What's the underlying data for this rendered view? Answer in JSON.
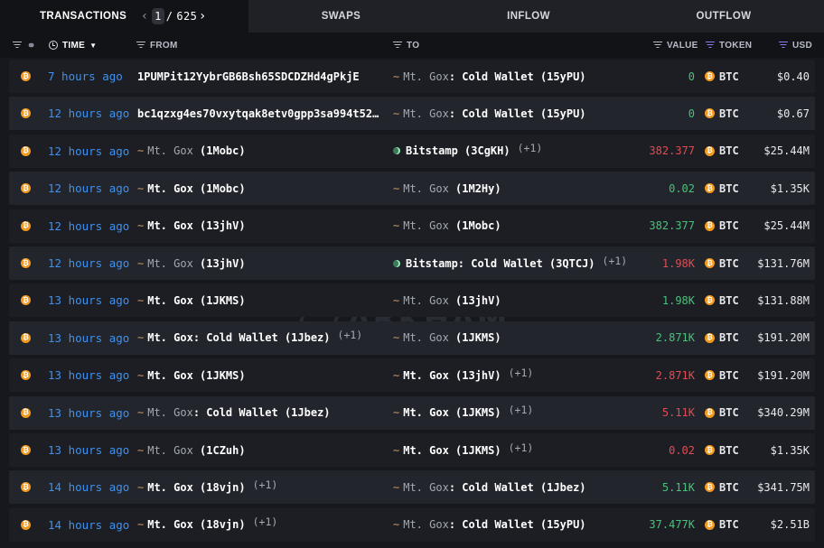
{
  "tabs": {
    "transactions": "TRANSACTIONS",
    "page_current": "1",
    "page_total": "625",
    "swaps": "SWAPS",
    "inflow": "INFLOW",
    "outflow": "OUTFLOW"
  },
  "header": {
    "time": "TIME",
    "from": "FROM",
    "to": "TO",
    "value": "VALUE",
    "token": "TOKEN",
    "usd": "USD"
  },
  "watermark": "ARKHAM",
  "colors": {
    "accent_time": "#3e91f0",
    "inflow": "#49c27b",
    "outflow": "#e14d52",
    "btc": "#f49a1e"
  },
  "rows": [
    {
      "time": "7 hours ago",
      "from": {
        "type": "address",
        "text": "1PUMPit12YybrGB6Bsh65SDCDZHd4gPkjE"
      },
      "to": {
        "type": "gox",
        "name": "Mt. Gox",
        "label": ": Cold Wallet (15yPU)",
        "bold": false,
        "plus": ""
      },
      "value": "0",
      "dir": "in",
      "token": "BTC",
      "usd": "$0.40"
    },
    {
      "time": "12 hours ago",
      "from": {
        "type": "address",
        "text": "bc1qzxg4es70vxytqak8etv0gpp3sa994t52…"
      },
      "to": {
        "type": "gox",
        "name": "Mt. Gox",
        "label": ": Cold Wallet (15yPU)",
        "bold": false,
        "plus": ""
      },
      "value": "0",
      "dir": "in",
      "token": "BTC",
      "usd": "$0.67"
    },
    {
      "time": "12 hours ago",
      "from": {
        "type": "gox",
        "name": "Mt. Gox",
        "label": " (1Mobc)",
        "bold": false,
        "plus": ""
      },
      "to": {
        "type": "bitstamp",
        "name": "Bitstamp",
        "label": " (3CgKH)",
        "bold": true,
        "plus": "(+1)"
      },
      "value": "382.377",
      "dir": "out",
      "token": "BTC",
      "usd": "$25.44M"
    },
    {
      "time": "12 hours ago",
      "from": {
        "type": "gox",
        "name": "Mt. Gox",
        "label": " (1Mobc)",
        "bold": true,
        "plus": ""
      },
      "to": {
        "type": "gox",
        "name": "Mt. Gox",
        "label": " (1M2Hy)",
        "bold": false,
        "plus": ""
      },
      "value": "0.02",
      "dir": "in",
      "token": "BTC",
      "usd": "$1.35K"
    },
    {
      "time": "12 hours ago",
      "from": {
        "type": "gox",
        "name": "Mt. Gox",
        "label": " (13jhV)",
        "bold": true,
        "plus": ""
      },
      "to": {
        "type": "gox",
        "name": "Mt. Gox",
        "label": " (1Mobc)",
        "bold": false,
        "plus": ""
      },
      "value": "382.377",
      "dir": "in",
      "token": "BTC",
      "usd": "$25.44M"
    },
    {
      "time": "12 hours ago",
      "from": {
        "type": "gox",
        "name": "Mt. Gox",
        "label": " (13jhV)",
        "bold": false,
        "plus": ""
      },
      "to": {
        "type": "bitstamp",
        "name": "Bitstamp",
        "label": ": Cold Wallet (3QTCJ)",
        "bold": true,
        "plus": "(+1)"
      },
      "value": "1.98K",
      "dir": "out",
      "token": "BTC",
      "usd": "$131.76M"
    },
    {
      "time": "13 hours ago",
      "from": {
        "type": "gox",
        "name": "Mt. Gox",
        "label": " (1JKMS)",
        "bold": true,
        "plus": ""
      },
      "to": {
        "type": "gox",
        "name": "Mt. Gox",
        "label": " (13jhV)",
        "bold": false,
        "plus": ""
      },
      "value": "1.98K",
      "dir": "in",
      "token": "BTC",
      "usd": "$131.88M"
    },
    {
      "time": "13 hours ago",
      "from": {
        "type": "gox",
        "name": "Mt. Gox",
        "label": ": Cold Wallet (1Jbez)",
        "bold": true,
        "plus": "(+1)"
      },
      "to": {
        "type": "gox",
        "name": "Mt. Gox",
        "label": " (1JKMS)",
        "bold": false,
        "plus": ""
      },
      "value": "2.871K",
      "dir": "in",
      "token": "BTC",
      "usd": "$191.20M"
    },
    {
      "time": "13 hours ago",
      "from": {
        "type": "gox",
        "name": "Mt. Gox",
        "label": " (1JKMS)",
        "bold": true,
        "plus": ""
      },
      "to": {
        "type": "gox",
        "name": "Mt. Gox",
        "label": " (13jhV)",
        "bold": true,
        "plus": "(+1)"
      },
      "value": "2.871K",
      "dir": "out",
      "token": "BTC",
      "usd": "$191.20M"
    },
    {
      "time": "13 hours ago",
      "from": {
        "type": "gox",
        "name": "Mt. Gox",
        "label": ": Cold Wallet (1Jbez)",
        "bold": false,
        "plus": ""
      },
      "to": {
        "type": "gox",
        "name": "Mt. Gox",
        "label": " (1JKMS)",
        "bold": true,
        "plus": "(+1)"
      },
      "value": "5.11K",
      "dir": "out",
      "token": "BTC",
      "usd": "$340.29M"
    },
    {
      "time": "13 hours ago",
      "from": {
        "type": "gox",
        "name": "Mt. Gox",
        "label": " (1CZuh)",
        "bold": false,
        "plus": ""
      },
      "to": {
        "type": "gox",
        "name": "Mt. Gox",
        "label": " (1JKMS)",
        "bold": true,
        "plus": "(+1)"
      },
      "value": "0.02",
      "dir": "out",
      "token": "BTC",
      "usd": "$1.35K"
    },
    {
      "time": "14 hours ago",
      "from": {
        "type": "gox",
        "name": "Mt. Gox",
        "label": " (18vjn)",
        "bold": true,
        "plus": "(+1)"
      },
      "to": {
        "type": "gox",
        "name": "Mt. Gox",
        "label": ": Cold Wallet (1Jbez)",
        "bold": false,
        "plus": ""
      },
      "value": "5.11K",
      "dir": "in",
      "token": "BTC",
      "usd": "$341.75M"
    },
    {
      "time": "14 hours ago",
      "from": {
        "type": "gox",
        "name": "Mt. Gox",
        "label": " (18vjn)",
        "bold": true,
        "plus": "(+1)"
      },
      "to": {
        "type": "gox",
        "name": "Mt. Gox",
        "label": ": Cold Wallet (15yPU)",
        "bold": false,
        "plus": ""
      },
      "value": "37.477K",
      "dir": "in",
      "token": "BTC",
      "usd": "$2.51B"
    }
  ]
}
